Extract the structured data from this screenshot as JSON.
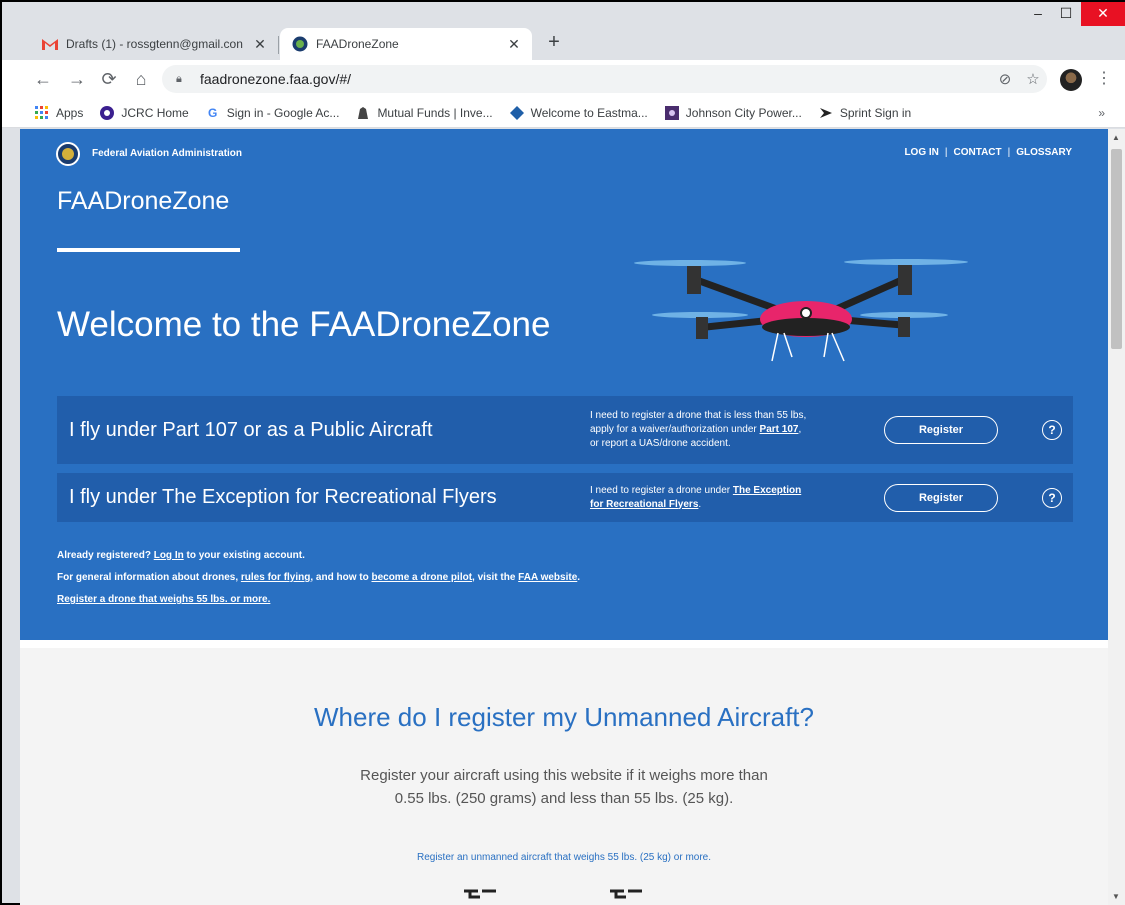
{
  "browser": {
    "tabs": [
      {
        "title": "Drafts (1) - rossgtenn@gmail.con",
        "icon": "gmail-icon",
        "active": false
      },
      {
        "title": "FAADroneZone",
        "icon": "faa-seal-icon",
        "active": true
      }
    ],
    "tab_close": "✕",
    "new_tab": "+",
    "window_buttons": {
      "minimize": "–",
      "maximize": "☐",
      "close": "✕"
    },
    "url": "faadronezone.faa.gov/#/",
    "bookmarks": [
      {
        "label": "Apps",
        "icon": "apps-grid-icon"
      },
      {
        "label": "JCRC Home",
        "icon": "jcrc-icon"
      },
      {
        "label": "Sign in - Google Ac...",
        "icon": "google-icon"
      },
      {
        "label": "Mutual Funds | Inve...",
        "icon": "mutual-funds-icon"
      },
      {
        "label": "Welcome to Eastma...",
        "icon": "eastman-diamond-icon"
      },
      {
        "label": "Johnson City Power...",
        "icon": "jcp-icon"
      },
      {
        "label": "Sprint Sign in",
        "icon": "sprint-icon"
      }
    ],
    "bookmarks_more": "»"
  },
  "hero": {
    "agency": "Federal Aviation Administration",
    "links": {
      "login": "LOG IN",
      "contact": "CONTACT",
      "glossary": "GLOSSARY"
    },
    "brand": "FAADroneZone",
    "welcome": "Welcome to the FAADroneZone",
    "option1": {
      "label": "I fly under Part 107 or as a Public Aircraft",
      "desc_line1": "I need to register a drone that is less than 55 lbs,",
      "desc_line2_pre": "apply for a waiver/authorization under ",
      "desc_line2_link": "Part 107",
      "desc_line2_post": ",",
      "desc_line3": "or report a UAS/drone accident.",
      "button": "Register",
      "help": "?"
    },
    "option2": {
      "label": "I fly under The Exception for Recreational Flyers",
      "desc_line1_pre": "I need to register a drone under ",
      "desc_line1_link": "The Exception",
      "desc_line2_link": "for Recreational Flyers",
      "desc_line2_post": ".",
      "button": "Register",
      "help": "?"
    },
    "notes": {
      "line1_pre": "Already registered? ",
      "line1_link": "Log In",
      "line1_post": " to your existing account.",
      "line2_pre": "For general information about drones, ",
      "line2_link1": "rules for flying",
      "line2_mid": ", and how to ",
      "line2_link2": "become a drone pilot",
      "line2_mid2": ", visit the ",
      "line2_link3": "FAA website",
      "line2_post": ".",
      "line3_link": "Register a drone that weighs 55 lbs. or more."
    }
  },
  "lower": {
    "title": "Where do I register my Unmanned Aircraft?",
    "text_line1": "Register your aircraft using this website if it weighs more than",
    "text_line2": "0.55 lbs. (250 grams) and less than 55 lbs. (25 kg).",
    "link": "Register an unmanned aircraft that weighs 55 lbs. (25 kg) or more."
  },
  "colors": {
    "hero_blue": "#2970c2",
    "option_blue": "#215eab",
    "drone_pink": "#e8256b"
  }
}
